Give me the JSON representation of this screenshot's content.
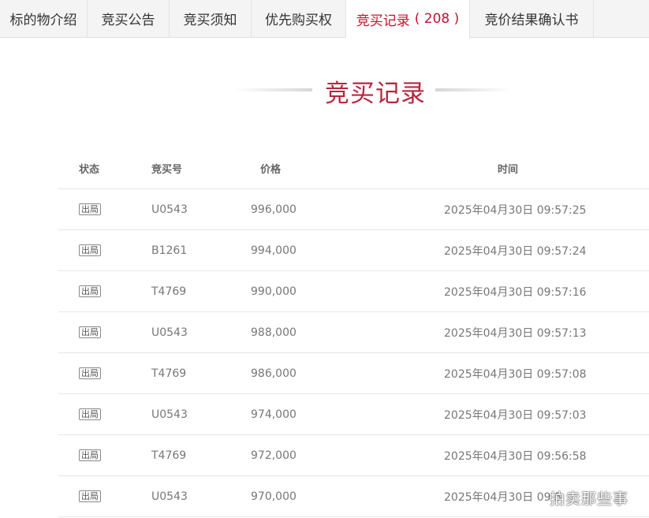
{
  "tabs": [
    {
      "label": "标的物介绍",
      "active": false
    },
    {
      "label": "竞买公告",
      "active": false
    },
    {
      "label": "竞买须知",
      "active": false
    },
    {
      "label": "优先购买权",
      "active": false
    },
    {
      "label": "竞买记录",
      "count": "( 208 )",
      "active": true
    },
    {
      "label": "竞价结果确认书",
      "active": false
    }
  ],
  "section_title": "竞买记录",
  "table": {
    "headers": {
      "status": "状态",
      "bid_number": "竞买号",
      "price": "价格",
      "time": "时间"
    },
    "rows": [
      {
        "status": "出局",
        "bid_number": "U0543",
        "price": "996,000",
        "time": "2025年04月30日 09:57:25"
      },
      {
        "status": "出局",
        "bid_number": "B1261",
        "price": "994,000",
        "time": "2025年04月30日 09:57:24"
      },
      {
        "status": "出局",
        "bid_number": "T4769",
        "price": "990,000",
        "time": "2025年04月30日 09:57:16"
      },
      {
        "status": "出局",
        "bid_number": "U0543",
        "price": "988,000",
        "time": "2025年04月30日 09:57:13"
      },
      {
        "status": "出局",
        "bid_number": "T4769",
        "price": "986,000",
        "time": "2025年04月30日 09:57:08"
      },
      {
        "status": "出局",
        "bid_number": "U0543",
        "price": "974,000",
        "time": "2025年04月30日 09:57:03"
      },
      {
        "status": "出局",
        "bid_number": "T4769",
        "price": "972,000",
        "time": "2025年04月30日 09:56:58"
      },
      {
        "status": "出局",
        "bid_number": "U0543",
        "price": "970,000",
        "time": "2025年04月30日 09:5"
      }
    ]
  },
  "watermark": "拍卖那些事",
  "colors": {
    "accent": "#c0142f",
    "title": "#b5283f",
    "tab_bg": "#f4f4f4"
  }
}
